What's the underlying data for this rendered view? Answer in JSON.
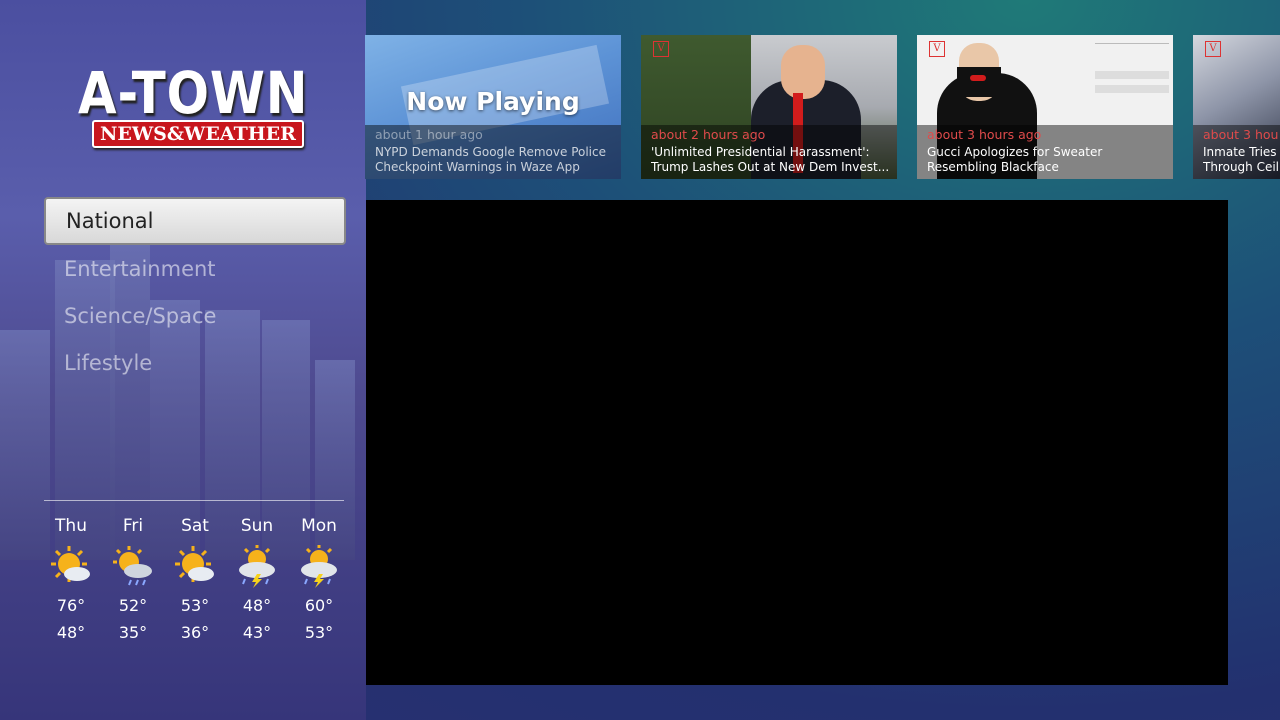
{
  "logo": {
    "main": "A-TOWN",
    "sub": "NEWS&WEATHER"
  },
  "nav": {
    "items": [
      {
        "label": "National",
        "active": true
      },
      {
        "label": "Entertainment",
        "active": false
      },
      {
        "label": "Science/Space",
        "active": false
      },
      {
        "label": "Lifestyle",
        "active": false
      }
    ]
  },
  "forecast": [
    {
      "day": "Thu",
      "icon": "sunny-partly-cloudy-icon",
      "high": "76°",
      "low": "48°"
    },
    {
      "day": "Fri",
      "icon": "sun-rain-icon",
      "high": "52°",
      "low": "35°"
    },
    {
      "day": "Sat",
      "icon": "sunny-partly-cloudy-icon",
      "high": "53°",
      "low": "36°"
    },
    {
      "day": "Sun",
      "icon": "sun-thunderstorm-icon",
      "high": "48°",
      "low": "43°"
    },
    {
      "day": "Mon",
      "icon": "sun-thunderstorm-icon",
      "high": "60°",
      "low": "53°"
    }
  ],
  "thumbnails": [
    {
      "badge": "Now Playing",
      "time": "about 1 hour ago",
      "title_line1": "NYPD Demands Google Remove Police",
      "title_line2": "Checkpoint Warnings in Waze App"
    },
    {
      "time": "about 2 hours ago",
      "title_line1": "'Unlimited Presidential Harassment':",
      "title_line2": "Trump Lashes Out at New Dem Invest..."
    },
    {
      "time": "about 3 hours ago",
      "title_line1": "Gucci Apologizes for Sweater",
      "title_line2": "Resembling Blackface"
    },
    {
      "time": "about 3 hou",
      "title_line1": "Inmate Tries",
      "title_line2": "Through Ceil"
    }
  ],
  "colors": {
    "accent_red": "#e04b4b",
    "video_bg": "#000000"
  }
}
